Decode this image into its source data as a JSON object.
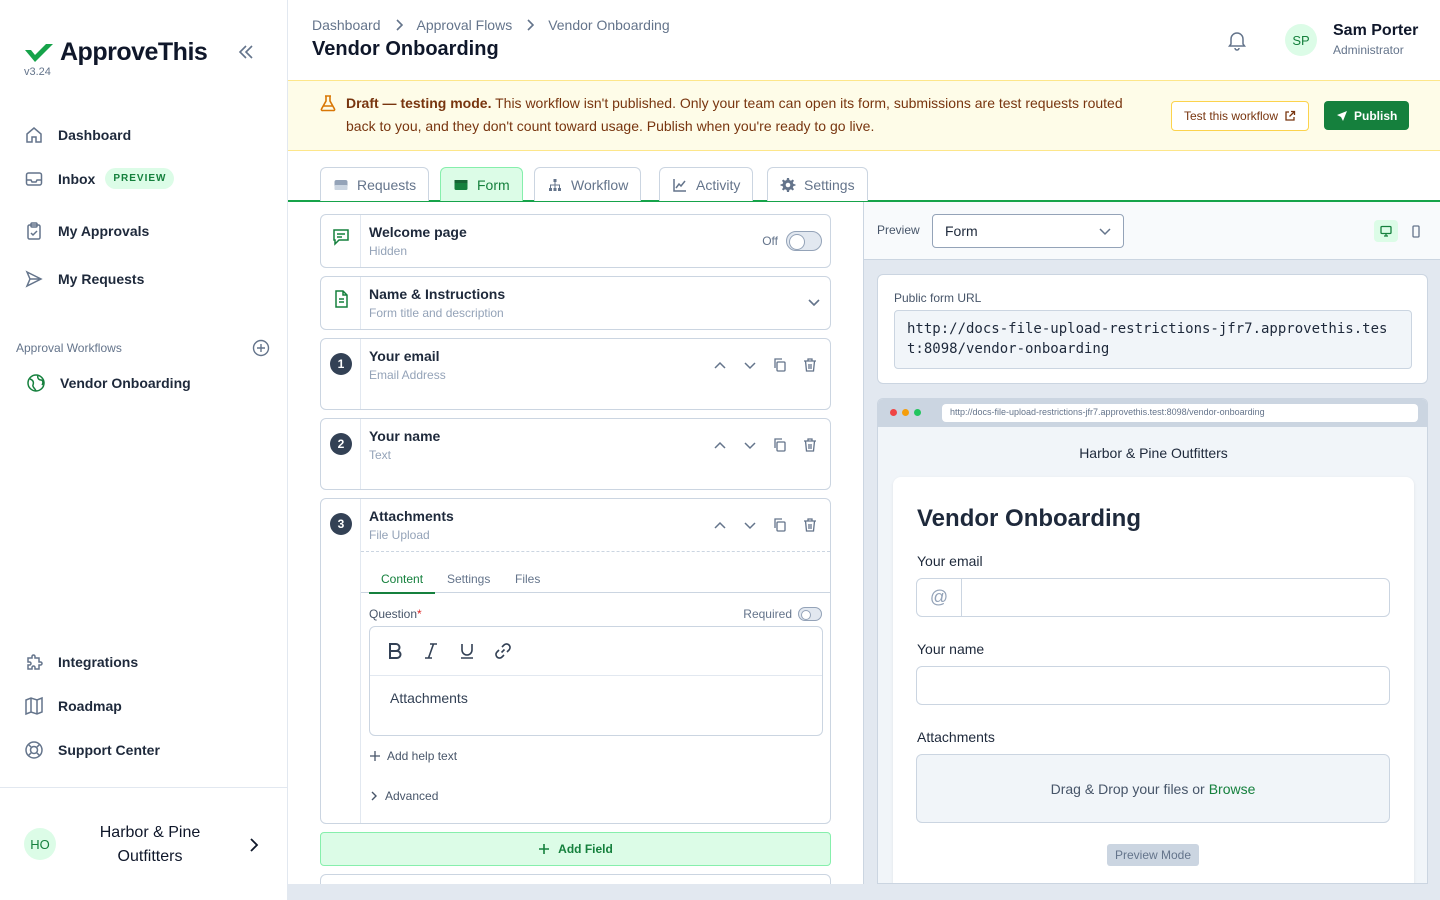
{
  "app": {
    "name": "ApproveThis",
    "version": "v3.24",
    "brand_color": "#15803d"
  },
  "sidebar": {
    "items": [
      {
        "label": "Dashboard",
        "icon": "home-icon"
      },
      {
        "label": "Inbox",
        "icon": "inbox-icon",
        "badge": "PREVIEW"
      },
      {
        "label": "My Approvals",
        "icon": "clipboard-check-icon"
      },
      {
        "label": "My Requests",
        "icon": "send-icon"
      }
    ],
    "section_label": "Approval Workflows",
    "workflows": [
      {
        "label": "Vendor Onboarding",
        "icon": "globe-icon"
      }
    ],
    "footer_items": [
      {
        "label": "Integrations",
        "icon": "puzzle-icon"
      },
      {
        "label": "Roadmap",
        "icon": "map-icon"
      },
      {
        "label": "Support Center",
        "icon": "lifebuoy-icon"
      }
    ],
    "org": {
      "initials": "HO",
      "name": "Harbor & Pine Outfitters"
    }
  },
  "header": {
    "breadcrumb": [
      "Dashboard",
      "Approval Flows",
      "Vendor Onboarding"
    ],
    "title": "Vendor Onboarding",
    "user": {
      "initials": "SP",
      "name": "Sam Porter",
      "role": "Administrator"
    }
  },
  "banner": {
    "strong": "Draft — testing mode.",
    "text": " This workflow isn't published. Only your team can open its form, submissions are test requests routed back to you, and they don't count toward usage. Publish when you're ready to go live.",
    "test_label": "Test this workflow",
    "publish_label": "Publish"
  },
  "tabs": [
    {
      "label": "Requests",
      "icon": "inbox-icon",
      "active": false
    },
    {
      "label": "Form",
      "icon": "form-icon",
      "active": true
    },
    {
      "label": "Workflow",
      "icon": "workflow-icon",
      "active": false
    },
    {
      "label": "Activity",
      "icon": "chart-line-icon",
      "active": false
    },
    {
      "label": "Settings",
      "icon": "gear-icon",
      "active": false
    }
  ],
  "form_builder": {
    "welcome": {
      "title": "Welcome page",
      "subtitle": "Hidden",
      "toggle_label": "Off"
    },
    "name_instructions": {
      "title": "Name & Instructions",
      "subtitle": "Form title and description"
    },
    "fields": [
      {
        "number": "1",
        "title": "Your email",
        "type": "Email Address"
      },
      {
        "number": "2",
        "title": "Your name",
        "type": "Text"
      },
      {
        "number": "3",
        "title": "Attachments",
        "type": "File Upload"
      }
    ],
    "field_tabs": [
      "Content",
      "Settings",
      "Files"
    ],
    "question_label": "Question",
    "required_mark": "*",
    "required_label": "Required",
    "question_text": "Attachments",
    "add_help_text": "Add help text",
    "advanced": "Advanced",
    "add_field": "Add Field"
  },
  "preview": {
    "label": "Preview",
    "select_value": "Form",
    "public_url_label": "Public form URL",
    "public_url": "http://docs-file-upload-restrictions-jfr7.approvethis.test:8098/vendor-onboarding",
    "browser_url": "http://docs-file-upload-restrictions-jfr7.approvethis.test:8098/vendor-onboarding",
    "company": "Harbor & Pine Outfitters",
    "form_title": "Vendor Onboarding",
    "email_label": "Your email",
    "email_prefix": "@",
    "name_label": "Your name",
    "attachments_label": "Attachments",
    "drop_text": "Drag & Drop your files or",
    "browse": "Browse",
    "preview_mode": "Preview Mode"
  }
}
